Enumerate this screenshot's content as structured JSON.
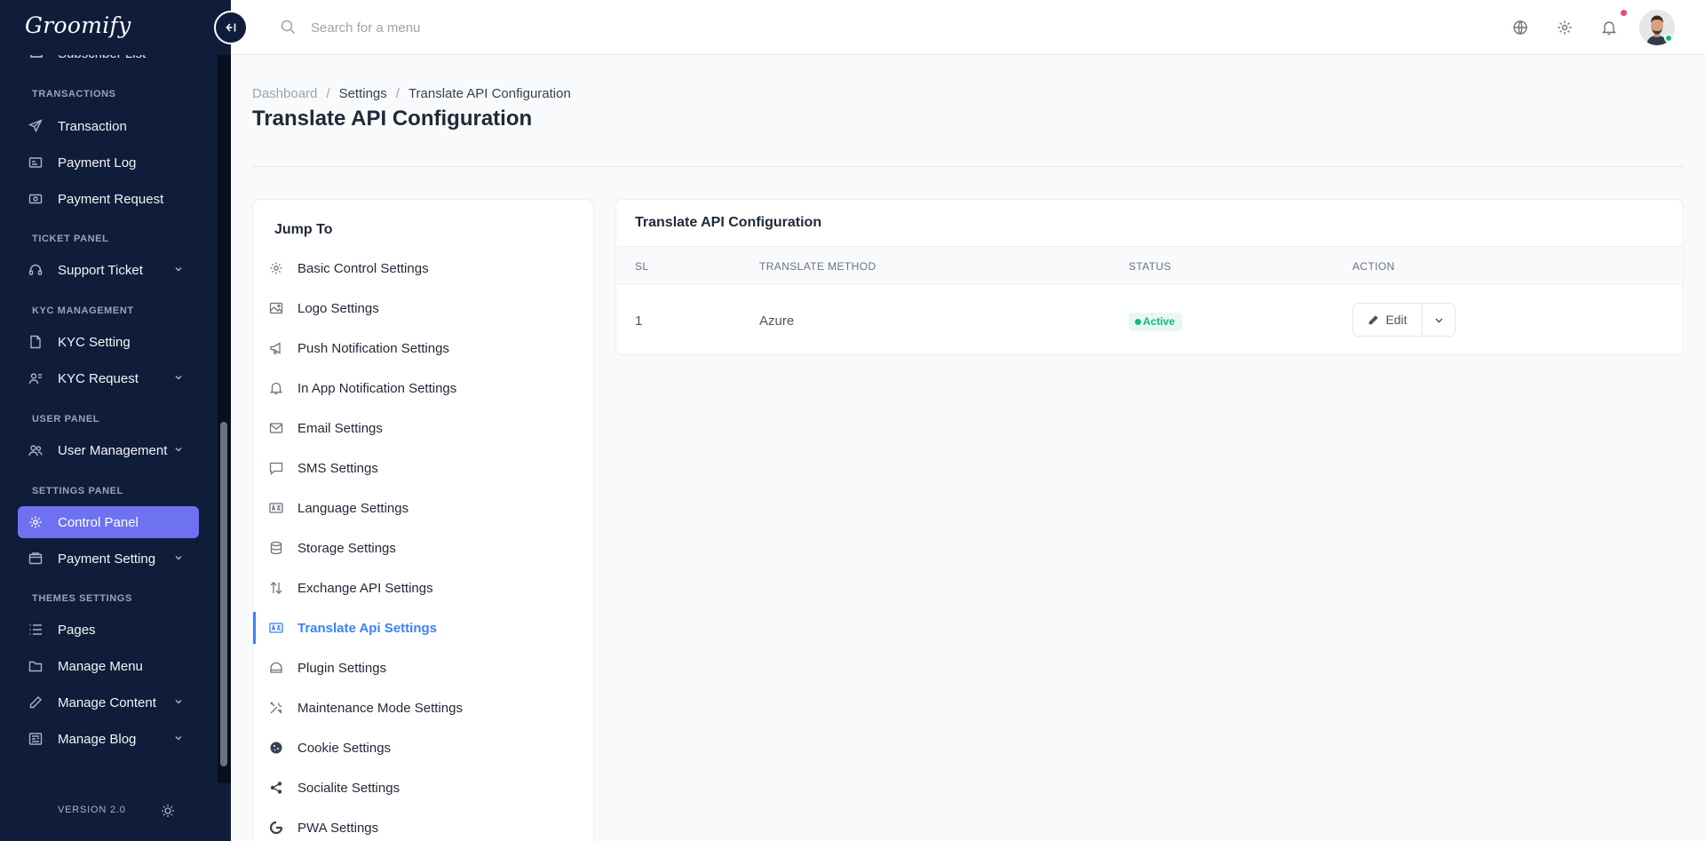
{
  "app": {
    "logo_text": "Groomify",
    "version": "VERSION 2.0"
  },
  "sidebar": {
    "partial_item": "Subscriber List",
    "sections": [
      {
        "label": "TRANSACTIONS"
      },
      {
        "label": "TICKET PANEL"
      },
      {
        "label": "KYC MANAGEMENT"
      },
      {
        "label": "USER PANEL"
      },
      {
        "label": "SETTINGS PANEL"
      },
      {
        "label": "THEMES SETTINGS"
      }
    ],
    "items": [
      {
        "label": "Transaction",
        "icon": "send-icon"
      },
      {
        "label": "Payment Log",
        "icon": "receipt-icon"
      },
      {
        "label": "Payment Request",
        "icon": "money-icon"
      },
      {
        "label": "Support Ticket",
        "icon": "headset-icon",
        "expandable": true
      },
      {
        "label": "KYC Setting",
        "icon": "document-icon"
      },
      {
        "label": "KYC Request",
        "icon": "user-card-icon",
        "expandable": true
      },
      {
        "label": "User Management",
        "icon": "users-icon",
        "expandable": true
      },
      {
        "label": "Control Panel",
        "icon": "gear-icon",
        "active": true
      },
      {
        "label": "Payment Setting",
        "icon": "wallet-icon",
        "expandable": true
      },
      {
        "label": "Pages",
        "icon": "list-icon"
      },
      {
        "label": "Manage Menu",
        "icon": "folder-icon"
      },
      {
        "label": "Manage Content",
        "icon": "pencil-icon",
        "expandable": true
      },
      {
        "label": "Manage Blog",
        "icon": "newspaper-icon",
        "expandable": true
      }
    ]
  },
  "topbar": {
    "search_placeholder": "Search for a menu",
    "icons": [
      "globe-icon",
      "gear-icon",
      "bell-icon"
    ]
  },
  "breadcrumb": [
    "Dashboard",
    "Settings",
    "Translate API Configuration"
  ],
  "page_title": "Translate API Configuration",
  "jump_to": {
    "title": "Jump To",
    "items": [
      {
        "label": "Basic Control Settings",
        "icon": "gear-icon"
      },
      {
        "label": "Logo Settings",
        "icon": "image-icon"
      },
      {
        "label": "Push Notification Settings",
        "icon": "megaphone-icon"
      },
      {
        "label": "In App Notification Settings",
        "icon": "bell-icon"
      },
      {
        "label": "Email Settings",
        "icon": "mail-icon"
      },
      {
        "label": "SMS Settings",
        "icon": "message-icon"
      },
      {
        "label": "Language Settings",
        "icon": "translate-icon"
      },
      {
        "label": "Storage Settings",
        "icon": "database-icon"
      },
      {
        "label": "Exchange API Settings",
        "icon": "swap-icon"
      },
      {
        "label": "Translate Api Settings",
        "icon": "translate-icon",
        "active": true
      },
      {
        "label": "Plugin Settings",
        "icon": "plugin-icon"
      },
      {
        "label": "Maintenance Mode Settings",
        "icon": "tools-icon"
      },
      {
        "label": "Cookie Settings",
        "icon": "cookie-icon"
      },
      {
        "label": "Socialite Settings",
        "icon": "share-icon"
      },
      {
        "label": "PWA Settings",
        "icon": "pwa-icon"
      }
    ]
  },
  "config": {
    "title": "Translate API Configuration",
    "columns": [
      "SL",
      "TRANSLATE METHOD",
      "STATUS",
      "ACTION"
    ],
    "rows": [
      {
        "sl": "1",
        "method": "Azure",
        "status": "Active",
        "edit_label": "Edit"
      }
    ]
  },
  "colors": {
    "sidebar_bg": "#0f1d3a",
    "accent": "#6f72f0",
    "link_active": "#3b82f6",
    "status_active": "#10b981"
  }
}
